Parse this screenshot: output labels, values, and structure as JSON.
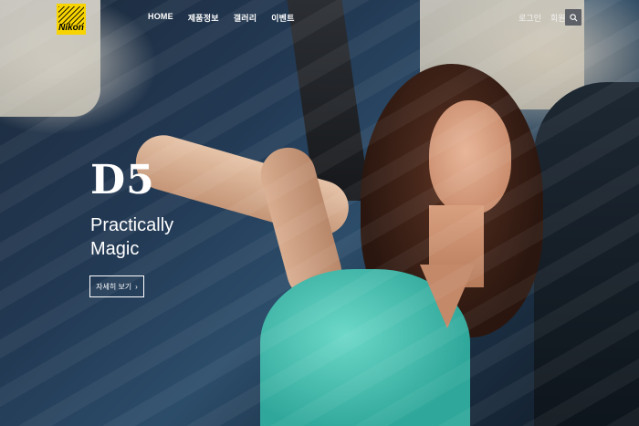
{
  "brand": {
    "logo_text": "Nikon"
  },
  "nav": {
    "items": [
      "HOME",
      "제품정보",
      "갤러리",
      "이벤트"
    ]
  },
  "utility": {
    "login": "로그인",
    "signup": "회원가입",
    "search_icon": "search-icon"
  },
  "hero": {
    "model": "D5",
    "tagline_line1": "Practically",
    "tagline_line2": "Magic",
    "cta_label": "자세히 보기",
    "cta_arrow": "›"
  },
  "colors": {
    "brand_yellow": "#f7d400",
    "dress_teal": "#3fb6a8",
    "search_bg": "#5d6066"
  }
}
